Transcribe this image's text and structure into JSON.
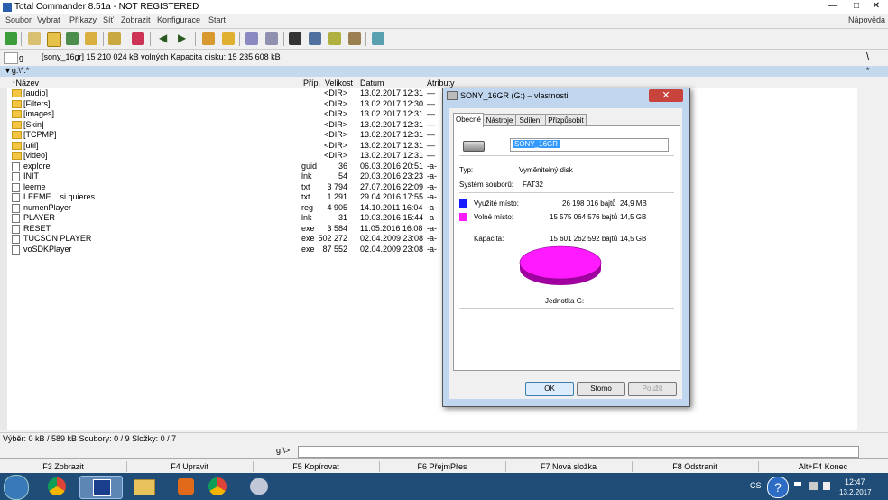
{
  "window": {
    "title": "Total Commander 8.51a - NOT REGISTERED"
  },
  "menu": {
    "items": [
      "Soubor",
      "Vybrat",
      "Příkazy",
      "Síť",
      "Zobrazit",
      "Konfigurace",
      "Start"
    ],
    "help": "Nápověda"
  },
  "drive": {
    "letter": "g",
    "info": "[sony_16gr]  15 210 024 kB volných  Kapacita disku: 15 235 608 kB"
  },
  "path": "▼g:\\*.*",
  "path_right": [
    "\\",
    "*"
  ],
  "columns": {
    "name": "↑Název",
    "ext": "Příp.",
    "size": "Velikost",
    "date": "Datum",
    "attr": "Atributy"
  },
  "files": [
    {
      "name": "[audio]",
      "ext": "",
      "size": "<DIR>",
      "date": "13.02.2017 12:31",
      "attr": "—",
      "type": "folder"
    },
    {
      "name": "[Filters]",
      "ext": "",
      "size": "<DIR>",
      "date": "13.02.2017 12:30",
      "attr": "—",
      "type": "folder"
    },
    {
      "name": "[images]",
      "ext": "",
      "size": "<DIR>",
      "date": "13.02.2017 12:31",
      "attr": "—",
      "type": "folder"
    },
    {
      "name": "[Skin]",
      "ext": "",
      "size": "<DIR>",
      "date": "13.02.2017 12:31",
      "attr": "—",
      "type": "folder"
    },
    {
      "name": "[TCPMP]",
      "ext": "",
      "size": "<DIR>",
      "date": "13.02.2017 12:31",
      "attr": "—",
      "type": "folder"
    },
    {
      "name": "[util]",
      "ext": "",
      "size": "<DIR>",
      "date": "13.02.2017 12:31",
      "attr": "—",
      "type": "folder"
    },
    {
      "name": "[video]",
      "ext": "",
      "size": "<DIR>",
      "date": "13.02.2017 12:31",
      "attr": "—",
      "type": "folder"
    },
    {
      "name": "explore",
      "ext": "guid",
      "size": "36",
      "date": "06.03.2016 20:51",
      "attr": "-a-",
      "type": "file"
    },
    {
      "name": "INIT",
      "ext": "lnk",
      "size": "54",
      "date": "20.03.2016 23:23",
      "attr": "-a-",
      "type": "file"
    },
    {
      "name": "leeme",
      "ext": "txt",
      "size": "3 794",
      "date": "27.07.2016 22:09",
      "attr": "-a-",
      "type": "file"
    },
    {
      "name": "LEEME ...si quieres",
      "ext": "txt",
      "size": "1 291",
      "date": "29.04.2016 17:55",
      "attr": "-a-",
      "type": "file"
    },
    {
      "name": "numenPlayer",
      "ext": "reg",
      "size": "4 905",
      "date": "14.10.2011 16:04",
      "attr": "-a-",
      "type": "file"
    },
    {
      "name": "PLAYER",
      "ext": "lnk",
      "size": "31",
      "date": "10.03.2016 15:44",
      "attr": "-a-",
      "type": "file"
    },
    {
      "name": "RESET",
      "ext": "exe",
      "size": "3 584",
      "date": "11.05.2016 16:08",
      "attr": "-a-",
      "type": "file"
    },
    {
      "name": "TUCSON PLAYER",
      "ext": "exe",
      "size": "502 272",
      "date": "02.04.2009 23:08",
      "attr": "-a-",
      "type": "file"
    },
    {
      "name": "voSDKPlayer",
      "ext": "exe",
      "size": "87 552",
      "date": "02.04.2009 23:08",
      "attr": "-a-",
      "type": "file"
    }
  ],
  "status": "Výběr: 0 kB / 589 kB   Soubory: 0 / 9   Složky: 0 / 7",
  "cmd_prompt": "g:\\>",
  "fkeys": [
    "F3 Zobrazit",
    "F4 Upravit",
    "F5 Kopírovat",
    "F6 PřejmPřes",
    "F7 Nová složka",
    "F8 Odstranit",
    "Alt+F4 Konec"
  ],
  "dialog": {
    "title": "SONY_16GR (G:) – vlastnosti",
    "tabs": [
      "Obecné",
      "Nástroje",
      "Sdílení",
      "Přizpůsobit"
    ],
    "label_value": "SONY_16GR",
    "type_label": "Typ:",
    "type_value": "Vyměnitelný disk",
    "fs_label": "Systém souborů:",
    "fs_value": "FAT32",
    "used_label": "Využité místo:",
    "used_bytes": "26 198 016 bajtů",
    "used_human": "24,9 MB",
    "free_label": "Volné místo:",
    "free_bytes": "15 575 064 576 bajtů",
    "free_human": "14,5 GB",
    "cap_label": "Kapacita:",
    "cap_bytes": "15 601 262 592 bajtů",
    "cap_human": "14,5 GB",
    "drive_label": "Jednotka G:",
    "ok": "OK",
    "cancel": "Storno",
    "apply": "Použít",
    "used_color": "#1a1aff",
    "free_color": "#ff1aff"
  },
  "taskbar": {
    "lang": "CS",
    "time": "12:47",
    "date": "13.2.2017"
  }
}
